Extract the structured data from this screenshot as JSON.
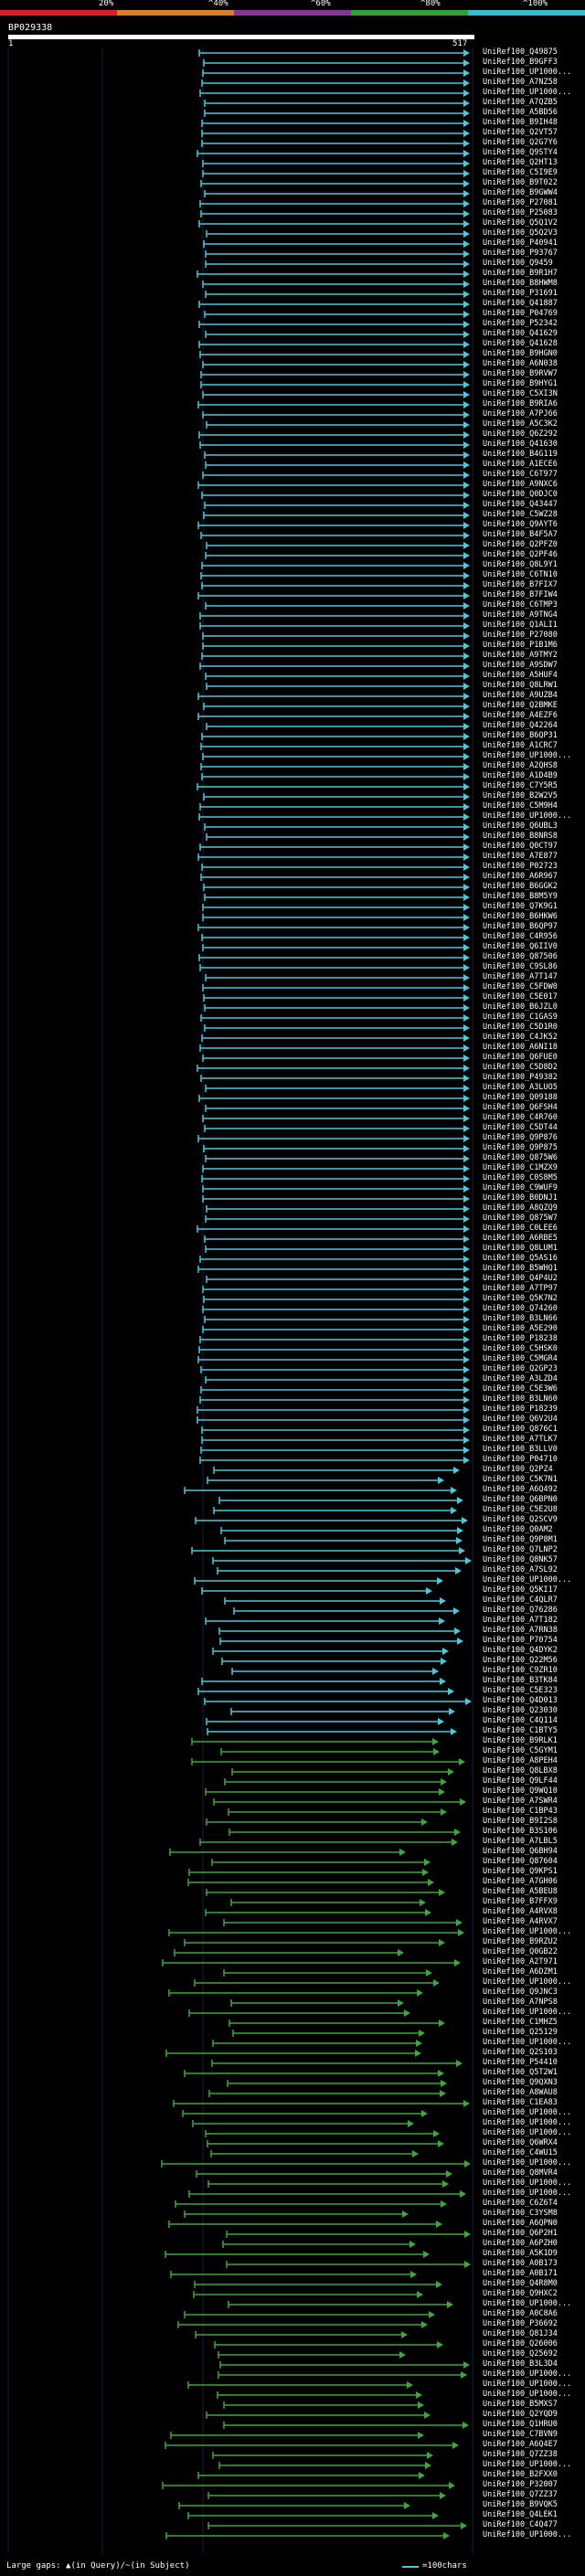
{
  "query": {
    "name": "BP029338",
    "start": "1",
    "end": "517"
  },
  "scale": [
    {
      "label": "20%",
      "color": "#e8191f"
    },
    {
      "label": "^40%",
      "color": "#e37b1f"
    },
    {
      "label": "^60%",
      "color": "#8e2fa0"
    },
    {
      "label": "^80%",
      "color": "#2aa62a"
    },
    {
      "label": "^100%",
      "color": "#2cc2d6"
    }
  ],
  "colors": {
    "cyan": "#48c8dc",
    "green": "#3aa83a"
  },
  "legend": {
    "footer": "Large gaps: ▲(in Query)/~(in Subject)",
    "unit": "=100chars"
  },
  "hits": [
    "UniRef100_Q49875",
    "UniRef100_B9GFF3",
    "UniRef100_UP1000...",
    "UniRef100_A7NZ58",
    "UniRef100_UP1000...",
    "UniRef100_A7QZB5",
    "UniRef100_A5BD56",
    "UniRef100_B9IH48",
    "UniRef100_Q2VT57",
    "UniRef100_Q2G7Y6",
    "UniRef100_Q9STY4",
    "UniRef100_Q2HT13",
    "UniRef100_C5I9E9",
    "UniRef100_B9T022",
    "UniRef100_B9GWW4",
    "UniRef100_P27081",
    "UniRef100_P25083",
    "UniRef100_Q5Q1V2",
    "UniRef100_Q5Q2V3",
    "UniRef100_P40941",
    "UniRef100_P93767",
    "UniRef100_Q9459",
    "UniRef100_B9R1H7",
    "UniRef100_B8HWM8",
    "UniRef100_P31691",
    "UniRef100_Q41887",
    "UniRef100_P04769",
    "UniRef100_P52342",
    "UniRef100_Q41629",
    "UniRef100_Q41628",
    "UniRef100_B9HGN0",
    "UniRef100_A6N038",
    "UniRef100_B9RVW7",
    "UniRef100_B9HYG1",
    "UniRef100_C5XI3N",
    "UniRef100_B9RIA6",
    "UniRef100_A7PJ66",
    "UniRef100_A5C3K2",
    "UniRef100_Q6Z292",
    "UniRef100_Q41630",
    "UniRef100_B4G119",
    "UniRef100_A1ECE6",
    "UniRef100_C6T977",
    "UniRef100_A9NXC6",
    "UniRef100_Q0DJC0",
    "UniRef100_Q43447",
    "UniRef100_C5WZ28",
    "UniRef100_Q9AYT6",
    "UniRef100_B4F5A7",
    "UniRef100_Q2PFZ0",
    "UniRef100_Q2PF46",
    "UniRef100_Q8L9Y1",
    "UniRef100_C6TN10",
    "UniRef100_B7FIX7",
    "UniRef100_B7FIW4",
    "UniRef100_C6TMP3",
    "UniRef100_A9TNG4",
    "UniRef100_Q1ALI1",
    "UniRef100_P27080",
    "UniRef100_P1B1M6",
    "UniRef100_A9TMY2",
    "UniRef100_A9SDW7",
    "UniRef100_A5HUF4",
    "UniRef100_Q8LRW1",
    "UniRef100_A9UZB4",
    "UniRef100_Q2BMKE",
    "UniRef100_A4EZF6",
    "UniRef100_Q42264",
    "UniRef100_B6QP31",
    "UniRef100_A1CRC7",
    "UniRef100_UP1000...",
    "UniRef100_A2QHS8",
    "UniRef100_A1D4B9",
    "UniRef100_C7Y5R5",
    "UniRef100_B2W2V5",
    "UniRef100_C5M9H4",
    "UniRef100_UP1000...",
    "UniRef100_Q6UBL3",
    "UniRef100_B8NRS8",
    "UniRef100_Q0CT97",
    "UniRef100_A7E877",
    "UniRef100_P02723",
    "UniRef100_A6R967",
    "UniRef100_B6GGK2",
    "UniRef100_B8M5Y9",
    "UniRef100_Q7K9G1",
    "UniRef100_B6HKW6",
    "UniRef100_B6QP97",
    "UniRef100_C4R956",
    "UniRef100_Q6IIV0",
    "UniRef100_Q87506",
    "UniRef100_C9SL86",
    "UniRef100_A7T147",
    "UniRef100_C5FDW0",
    "UniRef100_C5E017",
    "UniRef100_B6JZL0",
    "UniRef100_C1GAS9",
    "UniRef100_C5D1R0",
    "UniRef100_C4JK52",
    "UniRef100_A6NI18",
    "UniRef100_Q6FUE0",
    "UniRef100_C5D8D2",
    "UniRef100_P49382",
    "UniRef100_A3LUO5",
    "UniRef100_Q09188",
    "UniRef100_Q6FSH4",
    "UniRef100_C4R760",
    "UniRef100_C5DT44",
    "UniRef100_Q9P876",
    "UniRef100_Q9P875",
    "UniRef100_Q875W6",
    "UniRef100_C1MZX9",
    "UniRef100_C0S8M5",
    "UniRef100_C9WUF9",
    "UniRef100_B0DNJ1",
    "UniRef100_A8QZQ9",
    "UniRef100_Q875W7",
    "UniRef100_C0LEE6",
    "UniRef100_A6RBE5",
    "UniRef100_Q8LUM1",
    "UniRef100_Q5AS16",
    "UniRef100_B5WHQ1",
    "UniRef100_Q4P4U2",
    "UniRef100_A7TP97",
    "UniRef100_Q5K7N2",
    "UniRef100_Q74260",
    "UniRef100_B3LN66",
    "UniRef100_A5E290",
    "UniRef100_P18238",
    "UniRef100_C5HSK0",
    "UniRef100_C5MGR4",
    "UniRef100_Q2GP23",
    "UniRef100_A3LZD4",
    "UniRef100_C5E3W6",
    "UniRef100_B3LN60",
    "UniRef100_P18239",
    "UniRef100_Q6V2U4",
    "UniRef100_Q876C1",
    "UniRef100_A7TLK7",
    "UniRef100_B3LLV0",
    "UniRef100_P04710",
    "UniRef100_Q2PZ4",
    "UniRef100_C5K7N1",
    "UniRef100_A6Q492",
    "UniRef100_Q6BPN0",
    "UniRef100_C5E2U8",
    "UniRef100_Q2SCV9",
    "UniRef100_Q0AM2",
    "UniRef100_Q9P8M1",
    "UniRef100_Q7LNP2",
    "UniRef100_Q8NK57",
    "UniRef100_A7SL92",
    "UniRef100_UP1000...",
    "UniRef100_Q5KI17",
    "UniRef100_C4QLR7",
    "UniRef100_Q76286",
    "UniRef100_A7T182",
    "UniRef100_A7RN38",
    "UniRef100_P70754",
    "UniRef100_Q4DYK2",
    "UniRef100_Q22M56",
    "UniRef100_C9ZR10",
    "UniRef100_B3TK84",
    "UniRef100_C5E323",
    "UniRef100_Q4D013",
    "UniRef100_Q23030",
    "UniRef100_C4Q114",
    "UniRef100_C1BTY5",
    "UniRef100_B9RLK1",
    "UniRef100_C5GYM1",
    "UniRef100_A8PEH4",
    "UniRef100_Q8LBX8",
    "UniRef100_Q9LF44",
    "UniRef100_Q9WQ10",
    "UniRef100_A7SWR4",
    "UniRef100_C1BP43",
    "UniRef100_B9I2S8",
    "UniRef100_B3S106",
    "UniRef100_A7LBL5",
    "UniRef100_Q6BH94",
    "UniRef100_Q87604",
    "UniRef100_Q9KPS1",
    "UniRef100_A7GH06",
    "UniRef100_A5BEU8",
    "UniRef100_B7FFX9",
    "UniRef100_A4RVX8",
    "UniRef100_A4RVX7",
    "UniRef100_UP1000...",
    "UniRef100_B9RZU2",
    "UniRef100_Q0GB22",
    "UniRef100_A2T971",
    "UniRef100_A6DZM1",
    "UniRef100_UP1000...",
    "UniRef100_Q9JNC3",
    "UniRef100_A7NPS8",
    "UniRef100_UP1000...",
    "UniRef100_C1MHZ5",
    "UniRef100_Q25129",
    "UniRef100_UP1000...",
    "UniRef100_Q2S103",
    "UniRef100_P54410",
    "UniRef100_Q5T2W1",
    "UniRef100_Q9QXN3",
    "UniRef100_A8WAU8",
    "UniRef100_C1EA83",
    "UniRef100_UP1000...",
    "UniRef100_UP1000...",
    "UniRef100_UP1000...",
    "UniRef100_Q6WRX4",
    "UniRef100_C4WU15",
    "UniRef100_UP1000...",
    "UniRef100_Q8MVR4",
    "UniRef100_UP1000...",
    "UniRef100_UP1000...",
    "UniRef100_C6Z6T4",
    "UniRef100_C3YSM8",
    "UniRef100_A6QPN0",
    "UniRef100_Q6P2H1",
    "UniRef100_A6PZH0",
    "UniRef100_A5K1D9",
    "UniRef100_A0B173",
    "UniRef100_A0B171",
    "UniRef100_Q4R8M0",
    "UniRef100_Q9HXC2",
    "UniRef100_UP1000...",
    "UniRef100_A0C8A6",
    "UniRef100_P36692",
    "UniRef100_Q81J34",
    "UniRef100_Q26006",
    "UniRef100_Q25692",
    "UniRef100_B3L3D4",
    "UniRef100_UP1000...",
    "UniRef100_UP1000...",
    "UniRef100_UP1000...",
    "UniRef100_B5MXS7",
    "UniRef100_Q2YQD9",
    "UniRef100_Q1HRU0",
    "UniRef100_C7BVN9",
    "UniRef100_A6Q4E7",
    "UniRef100_Q7ZZ38",
    "UniRef100_UP1000...",
    "UniRef100_B2FXX0",
    "UniRef100_P32007",
    "UniRef100_Q7ZZ37",
    "UniRef100_B9VQK5",
    "UniRef100_Q4LEK1",
    "UniRef100_C4Q477",
    "UniRef100_UP1000..."
  ]
}
